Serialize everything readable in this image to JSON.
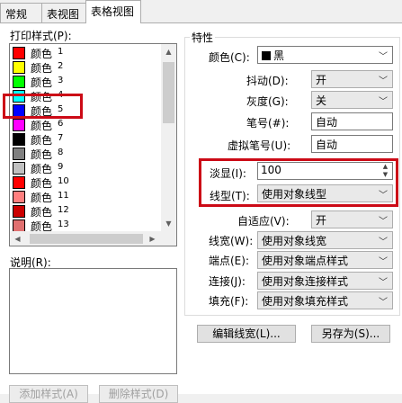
{
  "tabs": [
    {
      "label": "常规"
    },
    {
      "label": "表视图"
    },
    {
      "label": "表格视图"
    }
  ],
  "left": {
    "styles_label": "打印样式(P):",
    "items": [
      {
        "name": "颜色",
        "num": "1",
        "color": "#ff0000"
      },
      {
        "name": "颜色",
        "num": "2",
        "color": "#ffff00"
      },
      {
        "name": "颜色",
        "num": "3",
        "color": "#00ff00"
      },
      {
        "name": "颜色",
        "num": "4",
        "color": "#00ffff"
      },
      {
        "name": "颜色",
        "num": "5",
        "color": "#0000ff"
      },
      {
        "name": "颜色",
        "num": "6",
        "color": "#ff00ff"
      },
      {
        "name": "颜色",
        "num": "7",
        "color": "#000000"
      },
      {
        "name": "颜色",
        "num": "8",
        "color": "#808080"
      },
      {
        "name": "颜色",
        "num": "9",
        "color": "#c0c0c0"
      },
      {
        "name": "颜色",
        "num": "10",
        "color": "#ff0000"
      },
      {
        "name": "颜色",
        "num": "11",
        "color": "#ff7f7f"
      },
      {
        "name": "颜色",
        "num": "12",
        "color": "#cc0000"
      },
      {
        "name": "颜色",
        "num": "13",
        "color": "#e07070"
      }
    ],
    "desc_label": "说明(R):",
    "add_button": "添加样式(A)",
    "delete_button": "删除样式(D)"
  },
  "props": {
    "group_label": "特性",
    "color_label": "颜色(C):",
    "color_value": "黑",
    "dither_label": "抖动(D):",
    "dither_value": "开",
    "gray_label": "灰度(G):",
    "gray_value": "关",
    "pen_label": "笔号(#):",
    "pen_value": "自动",
    "vpen_label": "虚拟笔号(U):",
    "vpen_value": "自动",
    "screen_label": "淡显(I):",
    "screen_value": "100",
    "linetype_label": "线型(T):",
    "linetype_value": "使用对象线型",
    "adaptive_label": "自适应(V):",
    "adaptive_value": "开",
    "lineweight_label": "线宽(W):",
    "lineweight_value": "使用对象线宽",
    "endpoint_label": "端点(E):",
    "endpoint_value": "使用对象端点样式",
    "join_label": "连接(J):",
    "join_value": "使用对象连接样式",
    "fill_label": "填充(F):",
    "fill_value": "使用对象填充样式"
  },
  "buttons": {
    "edit_lineweight": "编辑线宽(L)...",
    "save_as": "另存为(S)..."
  },
  "highlight_color": "#cc0a16"
}
